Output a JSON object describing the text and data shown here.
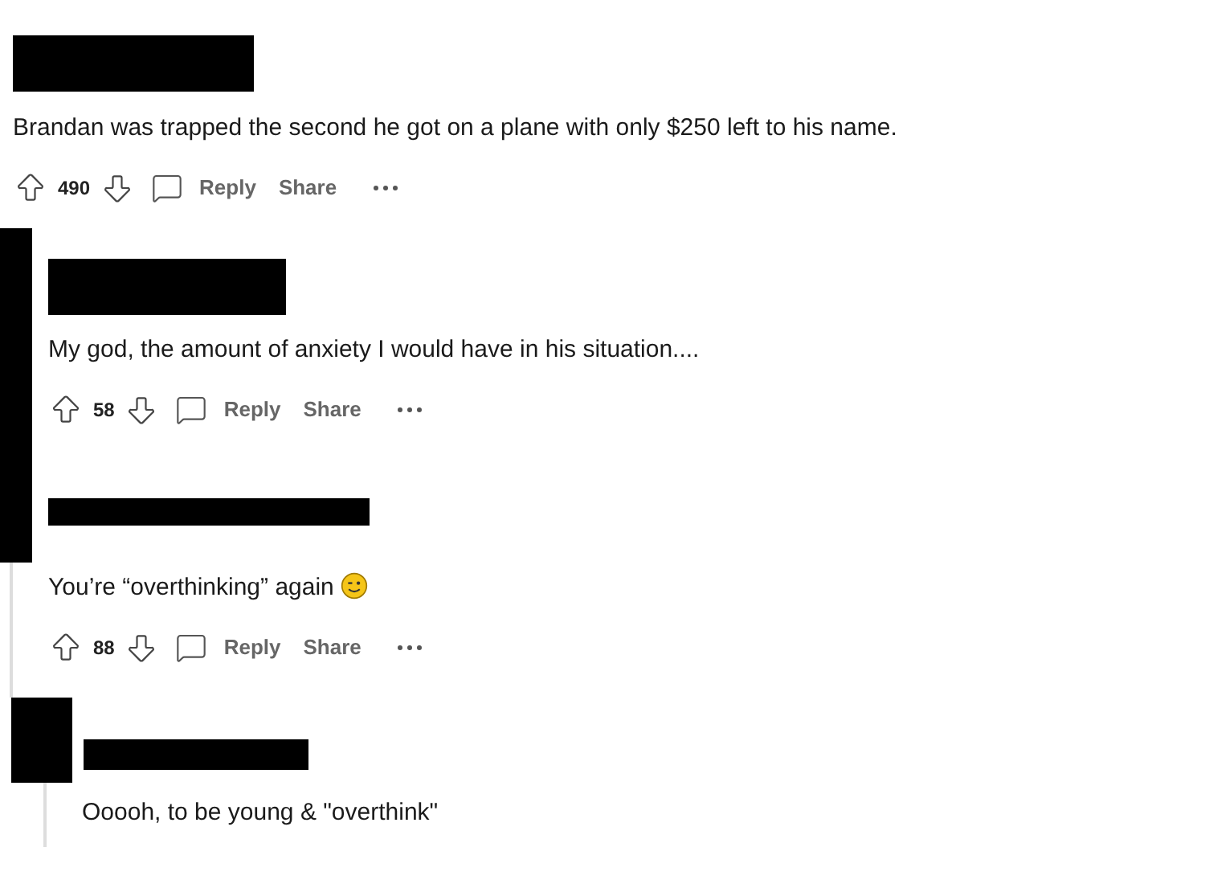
{
  "comments": [
    {
      "kind": "text",
      "body": "Brandan was trapped the second he got on a plane with only $250 left to his name.",
      "votes": "490",
      "actions": [
        "Reply",
        "Share"
      ]
    },
    {
      "kind": "text",
      "body": "My god, the amount of anxiety I would have in his situation....",
      "votes": "58",
      "actions": [
        "Reply",
        "Share"
      ]
    },
    {
      "kind": "text_with_emoji",
      "body": "You’re “overthinking” again",
      "votes": "88",
      "actions": [
        "Reply",
        "Share"
      ]
    },
    {
      "kind": "text",
      "body": "Ooooh, to be young & \"overthink\""
    }
  ]
}
